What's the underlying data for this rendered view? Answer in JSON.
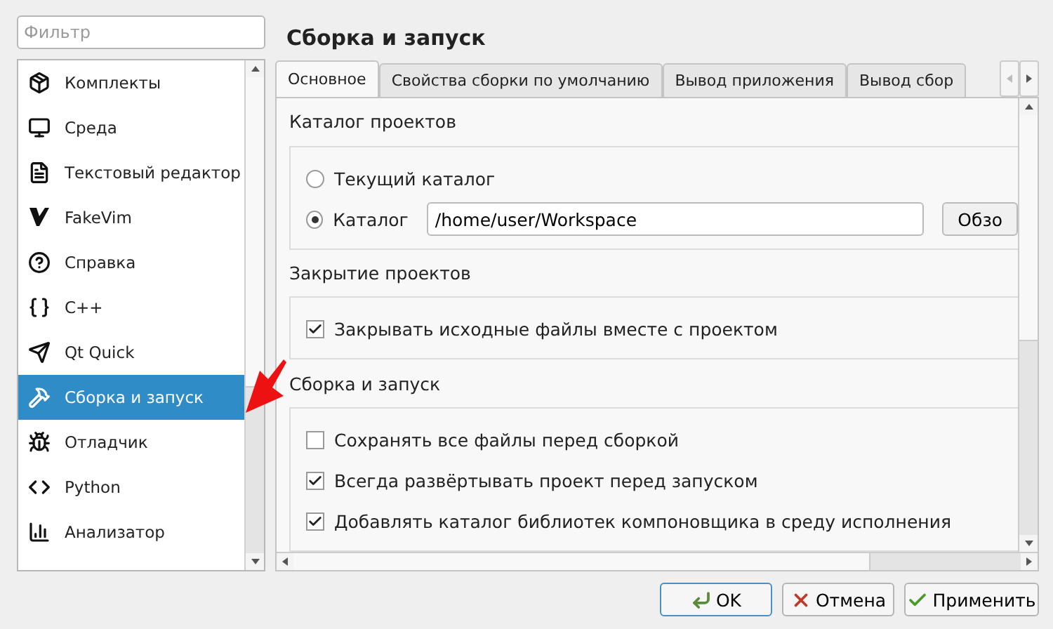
{
  "filter": {
    "placeholder": "Фильтр"
  },
  "sidebar": {
    "items": [
      {
        "kind": "kits",
        "label": "Комплекты",
        "selected": false
      },
      {
        "kind": "environment",
        "label": "Среда",
        "selected": false
      },
      {
        "kind": "editor",
        "label": "Текстовый редактор",
        "selected": false
      },
      {
        "kind": "fakevim",
        "label": "FakeVim",
        "selected": false
      },
      {
        "kind": "help",
        "label": "Справка",
        "selected": false
      },
      {
        "kind": "cpp",
        "label": "C++",
        "selected": false
      },
      {
        "kind": "quick",
        "label": "Qt Quick",
        "selected": false
      },
      {
        "kind": "build",
        "label": "Сборка и запуск",
        "selected": true
      },
      {
        "kind": "debugger",
        "label": "Отладчик",
        "selected": false
      },
      {
        "kind": "python",
        "label": "Python",
        "selected": false
      },
      {
        "kind": "analyzer",
        "label": "Анализатор",
        "selected": false
      }
    ]
  },
  "page_title": "Сборка и запуск",
  "tabs": [
    {
      "label": "Основное",
      "selected": true
    },
    {
      "label": "Свойства сборки по умолчанию",
      "selected": false
    },
    {
      "label": "Вывод приложения",
      "selected": false
    },
    {
      "label": "Вывод сбор",
      "selected": false
    }
  ],
  "sections": [
    {
      "title": "Каталог проектов",
      "rows": [
        {
          "kind": "radio",
          "label": "Текущий каталог",
          "selected": false
        },
        {
          "kind": "path",
          "label": "Каталог",
          "selected": true,
          "value": "/home/user/Workspace",
          "button": "Обзо"
        }
      ]
    },
    {
      "title": "Закрытие проектов",
      "rows": [
        {
          "kind": "checkbox",
          "label": "Закрывать исходные файлы вместе с проектом",
          "checked": true
        }
      ]
    },
    {
      "title": "Сборка и запуск",
      "rows": [
        {
          "kind": "checkbox",
          "label": "Сохранять все файлы перед сборкой",
          "checked": false
        },
        {
          "kind": "checkbox",
          "label": "Всегда развёртывать проект перед запуском",
          "checked": true
        },
        {
          "kind": "checkbox",
          "label": "Добавлять каталог библиотек компоновщика в среду исполнения",
          "checked": true
        }
      ]
    }
  ],
  "buttons": [
    {
      "kind": "ok",
      "label": "OK",
      "default": true
    },
    {
      "kind": "cancel",
      "label": "Отмена",
      "default": false
    },
    {
      "kind": "apply",
      "label": "Применить",
      "default": false
    }
  ]
}
